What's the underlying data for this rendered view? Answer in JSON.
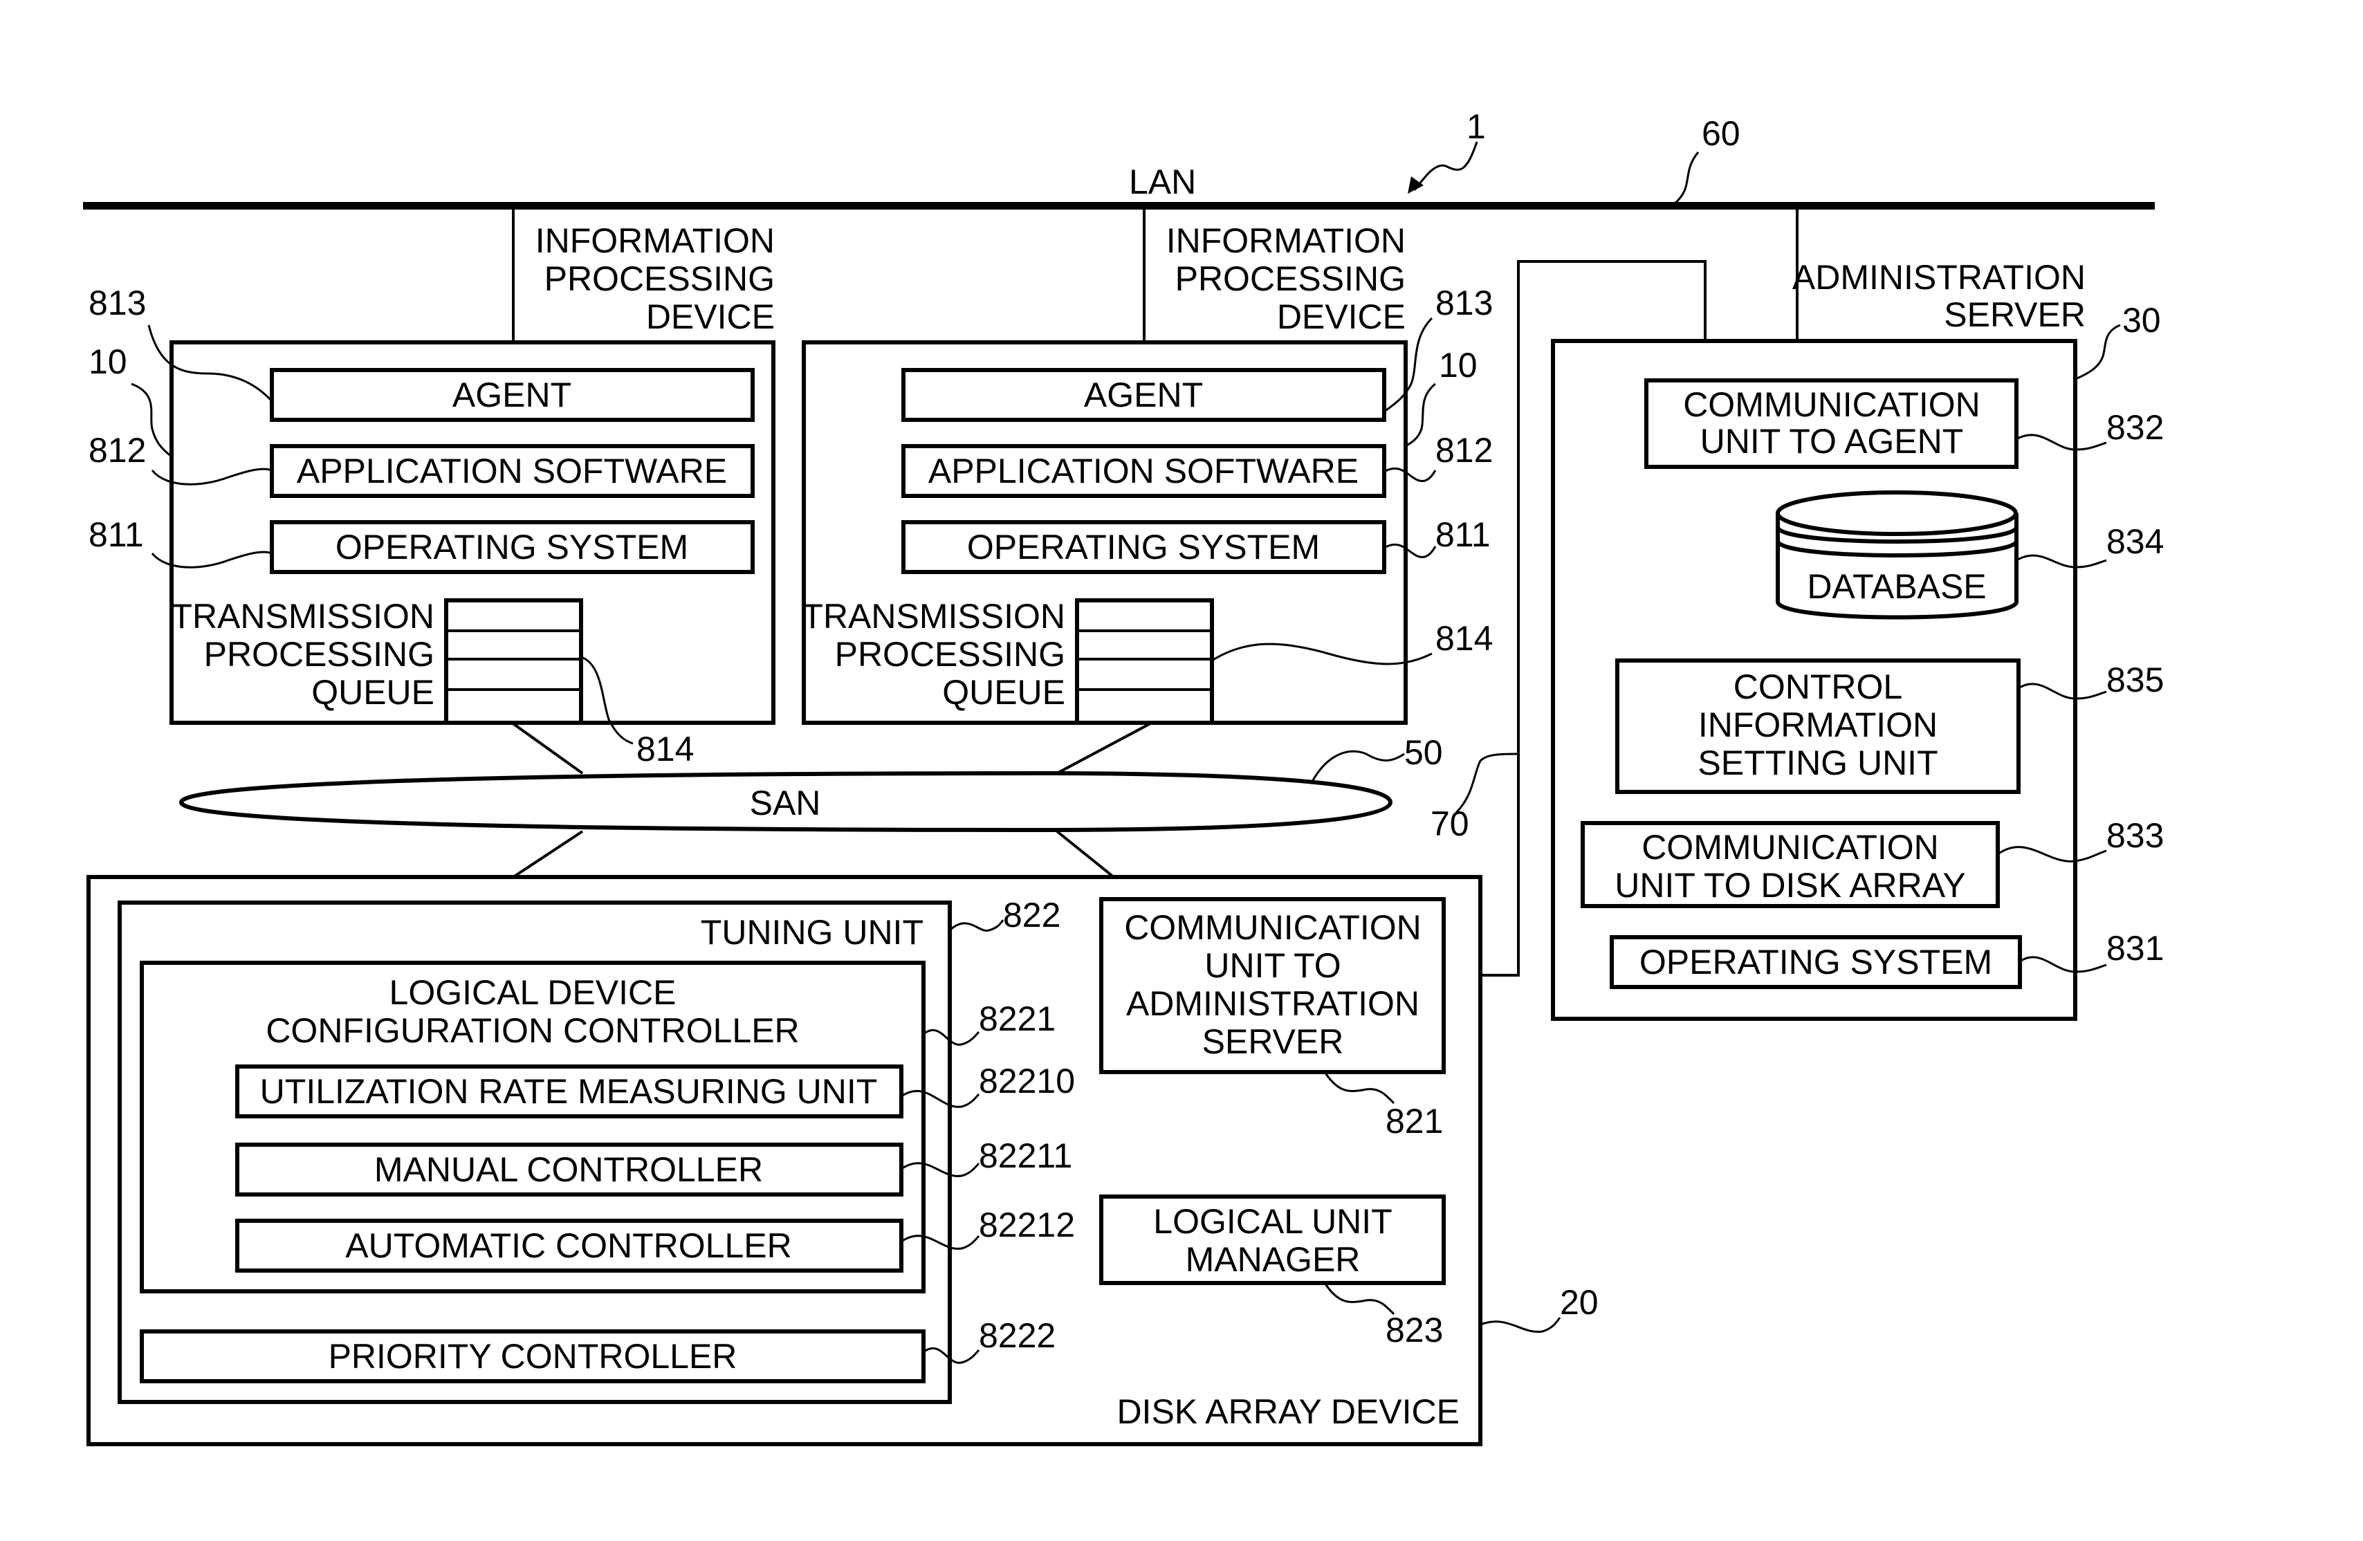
{
  "figure": {
    "system_ref": "1",
    "lan": {
      "label": "LAN",
      "ref": "60"
    },
    "san": {
      "label": "SAN",
      "ref": "50"
    },
    "admin_link_ref": "70",
    "info_devices": [
      {
        "title_lines": [
          "INFORMATION",
          "PROCESSING",
          "DEVICE"
        ],
        "ref": "10",
        "agent": {
          "label": "AGENT",
          "ref": "813"
        },
        "app": {
          "label": "APPLICATION SOFTWARE",
          "ref": "812"
        },
        "os": {
          "label": "OPERATING SYSTEM",
          "ref": "811"
        },
        "queue": {
          "lines": [
            "TRANSMISSION",
            "PROCESSING",
            "QUEUE"
          ],
          "ref": "814"
        }
      },
      {
        "title_lines": [
          "INFORMATION",
          "PROCESSING",
          "DEVICE"
        ],
        "ref": "10",
        "agent": {
          "label": "AGENT",
          "ref": "813"
        },
        "app": {
          "label": "APPLICATION SOFTWARE",
          "ref": "812"
        },
        "os": {
          "label": "OPERATING SYSTEM",
          "ref": "811"
        },
        "queue": {
          "lines": [
            "TRANSMISSION",
            "PROCESSING",
            "QUEUE"
          ],
          "ref": "814"
        }
      }
    ],
    "admin_server": {
      "title_lines": [
        "ADMINISTRATION",
        "SERVER"
      ],
      "ref": "30",
      "comm_agent": {
        "lines": [
          "COMMUNICATION",
          "UNIT TO AGENT"
        ],
        "ref": "832"
      },
      "database": {
        "label": "DATABASE",
        "ref": "834"
      },
      "control_info": {
        "lines": [
          "CONTROL",
          "INFORMATION",
          "SETTING UNIT"
        ],
        "ref": "835"
      },
      "comm_disk": {
        "lines": [
          "COMMUNICATION",
          "UNIT TO DISK ARRAY"
        ],
        "ref": "833"
      },
      "os": {
        "label": "OPERATING SYSTEM",
        "ref": "831"
      }
    },
    "disk_array": {
      "title": "DISK ARRAY DEVICE",
      "ref": "20",
      "tuning_unit": {
        "label": "TUNING UNIT",
        "ref": "822",
        "ldcc": {
          "lines": [
            "LOGICAL DEVICE",
            "CONFIGURATION CONTROLLER"
          ],
          "ref": "8221",
          "util": {
            "label": "UTILIZATION RATE MEASURING UNIT",
            "ref": "82210"
          },
          "manual": {
            "label": "MANUAL CONTROLLER",
            "ref": "82211"
          },
          "auto": {
            "label": "AUTOMATIC CONTROLLER",
            "ref": "82212"
          }
        },
        "priority": {
          "label": "PRIORITY CONTROLLER",
          "ref": "8222"
        }
      },
      "comm_admin": {
        "lines": [
          "COMMUNICATION",
          "UNIT TO",
          "ADMINISTRATION",
          "SERVER"
        ],
        "ref": "821"
      },
      "lu_manager": {
        "lines": [
          "LOGICAL UNIT",
          "MANAGER"
        ],
        "ref": "823"
      }
    }
  }
}
